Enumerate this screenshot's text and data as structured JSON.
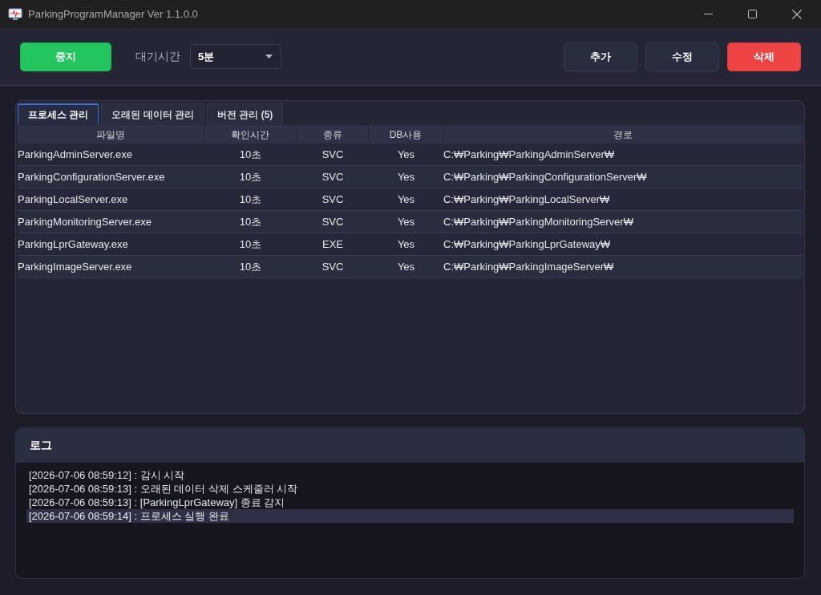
{
  "window": {
    "title": "ParkingProgramManager Ver 1.1.0.0"
  },
  "toolbar": {
    "left_button": {
      "label": "중지",
      "kind": "success"
    },
    "wait_label": "대기시간",
    "wait_select": {
      "value": "5분"
    },
    "buttons": [
      {
        "label": "추가",
        "kind": "normal"
      },
      {
        "label": "수정",
        "kind": "normal"
      },
      {
        "label": "삭제",
        "kind": "danger"
      }
    ]
  },
  "tabs": [
    {
      "label": "프로세스 관리",
      "selected": true
    },
    {
      "label": "오래된 데이터 관리",
      "selected": false
    },
    {
      "label": "버전 관리 (5)",
      "selected": false
    }
  ],
  "table": {
    "columns": [
      "파일명",
      "확인시간",
      "종류",
      "DB사용",
      "경로"
    ],
    "rows": [
      [
        "ParkingAdminServer.exe",
        "10초",
        "SVC",
        "Yes",
        "C:₩Parking₩ParkingAdminServer₩"
      ],
      [
        "ParkingConfigurationServer.exe",
        "10초",
        "SVC",
        "Yes",
        "C:₩Parking₩ParkingConfigurationServer₩"
      ],
      [
        "ParkingLocalServer.exe",
        "10초",
        "SVC",
        "Yes",
        "C:₩Parking₩ParkingLocalServer₩"
      ],
      [
        "ParkingMonitoringServer.exe",
        "10초",
        "SVC",
        "Yes",
        "C:₩Parking₩ParkingMonitoringServer₩"
      ],
      [
        "ParkingLprGateway.exe",
        "10초",
        "EXE",
        "Yes",
        "C:₩Parking₩ParkingLprGateway₩"
      ],
      [
        "ParkingImageServer.exe",
        "10초",
        "SVC",
        "Yes",
        "C:₩Parking₩ParkingImageServer₩"
      ]
    ]
  },
  "log": {
    "title": "로그",
    "lines": [
      {
        "text": "[2026-07-06 08:59:12] : 감시 시작",
        "selected": false
      },
      {
        "text": "[2026-07-06 08:59:13] : 오래된 데이터 삭제 스케줄러 시작",
        "selected": false
      },
      {
        "text": "[2026-07-06 08:59:13] : [ParkingLprGateway] 종료 감지",
        "selected": false
      },
      {
        "text": "[2026-07-06 08:59:14] : 프로세스 실행 완료",
        "selected": true
      }
    ]
  }
}
